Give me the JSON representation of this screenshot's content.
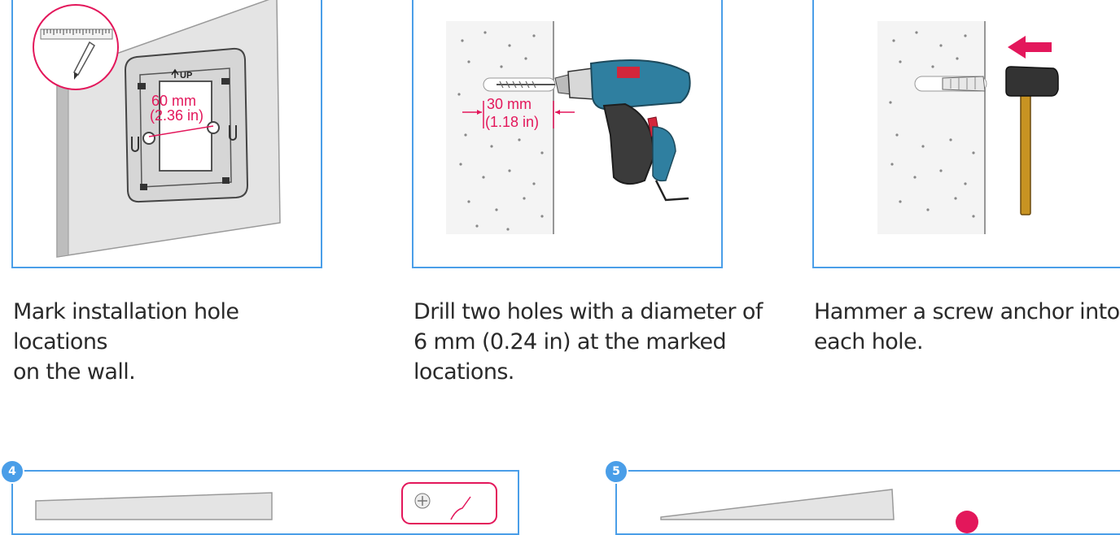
{
  "steps": [
    {
      "number": "",
      "caption": "Mark installation hole locations\non the wall.",
      "dim_line1": "60 mm",
      "dim_line2": "(2.36 in)",
      "up_label": "UP"
    },
    {
      "number": "",
      "caption": "Drill two holes with a diameter of\n6 mm (0.24 in) at the marked\nlocations.",
      "dim_line1": "30 mm",
      "dim_line2": "(1.18 in)"
    },
    {
      "number": "",
      "caption": "Hammer a screw anchor into\neach hole."
    },
    {
      "number": "4"
    },
    {
      "number": "5"
    }
  ],
  "colors": {
    "frame": "#4a9ee8",
    "accent": "#e3175b",
    "drill": "#2f7fa0"
  },
  "icons": [
    "ruler-pencil-icon",
    "drill-icon",
    "hammer-icon",
    "arrow-left-icon",
    "screwdriver-icon",
    "phillips-screw-icon"
  ]
}
